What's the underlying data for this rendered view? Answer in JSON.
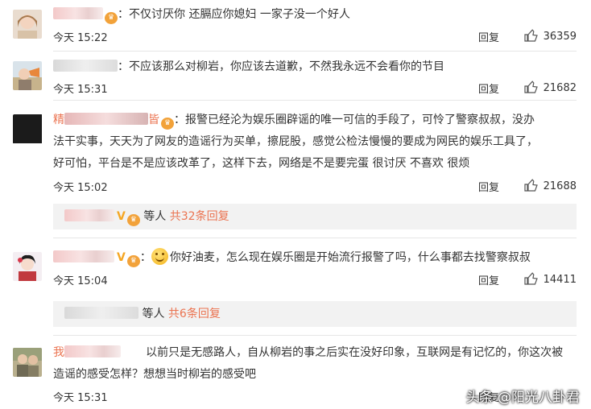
{
  "comments": [
    {
      "text": "：不仅讨厌你  还膈应你媳妇  一家子没一个好人",
      "time": "今天 15:22",
      "reply": "回复",
      "likes": "36359"
    },
    {
      "text": "：不应该那么对柳岩，你应该去道歉，不然我永远不会看你的节目",
      "time": "今天 15:31",
      "reply": "回复",
      "likes": "21682"
    },
    {
      "name_visible": "精",
      "name_tail": "皆",
      "text_line1": "：报警已经沦为娱乐圈辟谣的唯一可信的手段了，可怜了警察叔叔，没办",
      "text_line2": "法干实事，天天为了网友的造谣行为买单，擦屁股，感觉公检法慢慢的要成为网民的娱乐工具了，",
      "text_line3": "好可怕，平台是不是应该改革了，这样下去，网络是不是要完蛋  很讨厌 不喜欢 很烦",
      "time": "今天 15:02",
      "reply": "回复",
      "likes": "21688",
      "sub_prefix": "等人",
      "sub_count": "共32条回复"
    },
    {
      "text": "：",
      "text_after_emoji": "你好油麦，怎么现在娱乐圈是开始流行报警了吗，什么事都去找警察叔叔",
      "time": "今天 15:04",
      "reply": "回复",
      "likes": "14411",
      "sub_prefix": "等人",
      "sub_count": "共6条回复"
    },
    {
      "name_visible": "我",
      "text_line1": "以前只是无感路人，自从柳岩的事之后实在没好印象，互联网是有记忆的，你这次被",
      "text_line2": "造谣的感受怎样？想想当时柳岩的感受吧",
      "time": "今天 15:31",
      "reply": "回复"
    }
  ],
  "watermark": "头条 @阳光八卦君",
  "icons": {
    "like": "thumbs-up-icon",
    "vip": "vip-badge-icon",
    "emoji": "smile-emoji-icon"
  }
}
